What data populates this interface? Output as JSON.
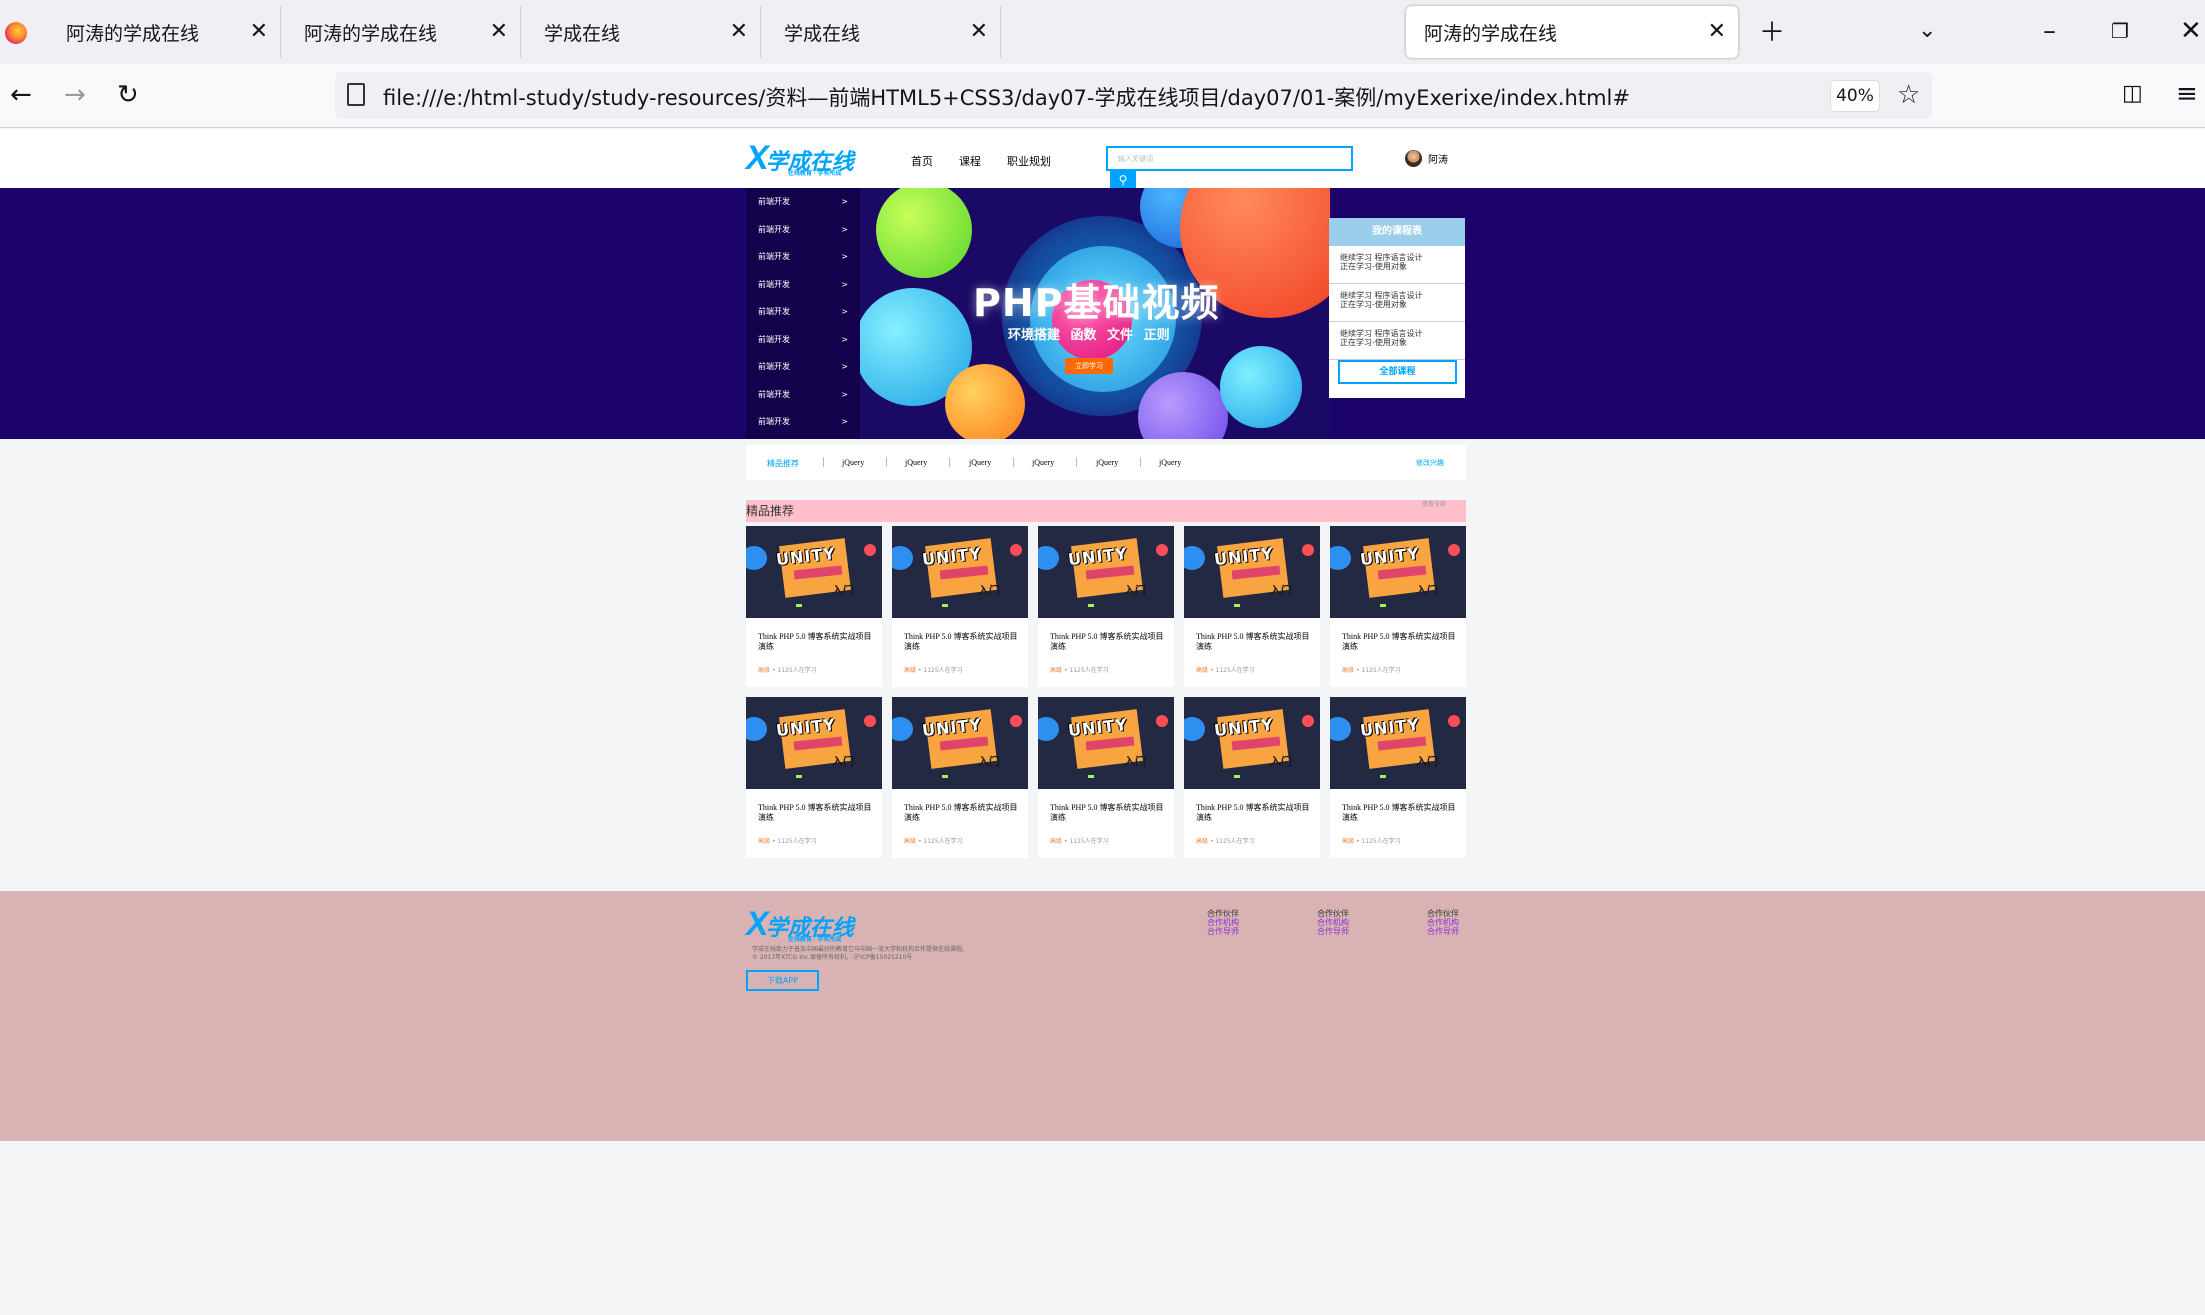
{
  "browser": {
    "tabs": [
      {
        "title": "阿涛的学成在线",
        "active": false
      },
      {
        "title": "阿涛的学成在线",
        "active": false
      },
      {
        "title": "学成在线",
        "active": false
      },
      {
        "title": "学成在线",
        "active": false
      },
      {
        "title": "阿涛的学成在线",
        "active": true
      }
    ],
    "url": "file:///e:/html-study/study-resources/资料—前端HTML5+CSS3/day07-学成在线项目/day07/01-案例/myExerixe/index.html#",
    "zoom": "40%"
  },
  "site": {
    "logo": {
      "mark": "X",
      "text": "学成在线",
      "slogan": "在线教育 · 学有所成"
    },
    "nav": [
      "首页",
      "课程",
      "职业规划"
    ],
    "search_placeholder": "输入关键词",
    "user_name": "阿涛",
    "sidebar": [
      {
        "label": "前端开发",
        "arrow": ">"
      },
      {
        "label": "前端开发",
        "arrow": ">"
      },
      {
        "label": "前端开发",
        "arrow": ">"
      },
      {
        "label": "前端开发",
        "arrow": ">"
      },
      {
        "label": "前端开发",
        "arrow": ">"
      },
      {
        "label": "前端开发",
        "arrow": ">"
      },
      {
        "label": "前端开发",
        "arrow": ">"
      },
      {
        "label": "前端开发",
        "arrow": ">"
      },
      {
        "label": "前端开发",
        "arrow": ">"
      }
    ],
    "hero": {
      "title": "PHP基础视频",
      "subtitle": "环境搭建 函数 文件 正则",
      "button": "立即学习"
    },
    "my_courses": {
      "title": "我的课程表",
      "items": [
        {
          "line1": "继续学习 程序语言设计",
          "line2": "正在学习-使用对象"
        },
        {
          "line1": "继续学习 程序语言设计",
          "line2": "正在学习-使用对象"
        },
        {
          "line1": "继续学习 程序语言设计",
          "line2": "正在学习-使用对象"
        }
      ],
      "all_button": "全部课程"
    },
    "filter": {
      "items": [
        "精品推荐",
        "jQuery",
        "jQuery",
        "jQuery",
        "jQuery",
        "jQuery",
        "jQuery"
      ],
      "edit": "修改兴趣"
    },
    "section": {
      "title": "精品推荐",
      "more": "查看全部"
    },
    "courses": [
      {
        "title": "Think PHP 5.0 博客系统实战项目演练",
        "level": "高级",
        "count": "• 1125人在学习"
      },
      {
        "title": "Think PHP 5.0 博客系统实战项目演练",
        "level": "高级",
        "count": "• 1125人在学习"
      },
      {
        "title": "Think PHP 5.0 博客系统实战项目演练",
        "level": "高级",
        "count": "• 1125人在学习"
      },
      {
        "title": "Think PHP 5.0 博客系统实战项目演练",
        "level": "高级",
        "count": "• 1125人在学习"
      },
      {
        "title": "Think PHP 5.0 博客系统实战项目演练",
        "level": "高级",
        "count": "• 1125人在学习"
      },
      {
        "title": "Think PHP 5.0 博客系统实战项目演练",
        "level": "高级",
        "count": "• 1125人在学习"
      },
      {
        "title": "Think PHP 5.0 博客系统实战项目演练",
        "level": "高级",
        "count": "• 1125人在学习"
      },
      {
        "title": "Think PHP 5.0 博客系统实战项目演练",
        "level": "高级",
        "count": "• 1125人在学习"
      },
      {
        "title": "Think PHP 5.0 博客系统实战项目演练",
        "level": "高级",
        "count": "• 1125人在学习"
      },
      {
        "title": "Think PHP 5.0 博客系统实战项目演练",
        "level": "高级",
        "count": "• 1125人在学习"
      }
    ],
    "course_image_text": {
      "logo": "UNITY",
      "tag": "入门"
    },
    "footer": {
      "desc1": "学成在线致力于普及中国最好的教育它与中国一流大学和机构合作提供在线课程。",
      "desc2": "© 2017年XTCG Inc.保留所有权利。-沪ICP备15025210号",
      "app_button": "下载APP",
      "link_groups": [
        {
          "title": "合作伙伴",
          "links": [
            "合作机构",
            "合作导师"
          ]
        },
        {
          "title": "合作伙伴",
          "links": [
            "合作机构",
            "合作导师"
          ]
        },
        {
          "title": "合作伙伴",
          "links": [
            "合作机构",
            "合作导师"
          ]
        }
      ]
    }
  }
}
